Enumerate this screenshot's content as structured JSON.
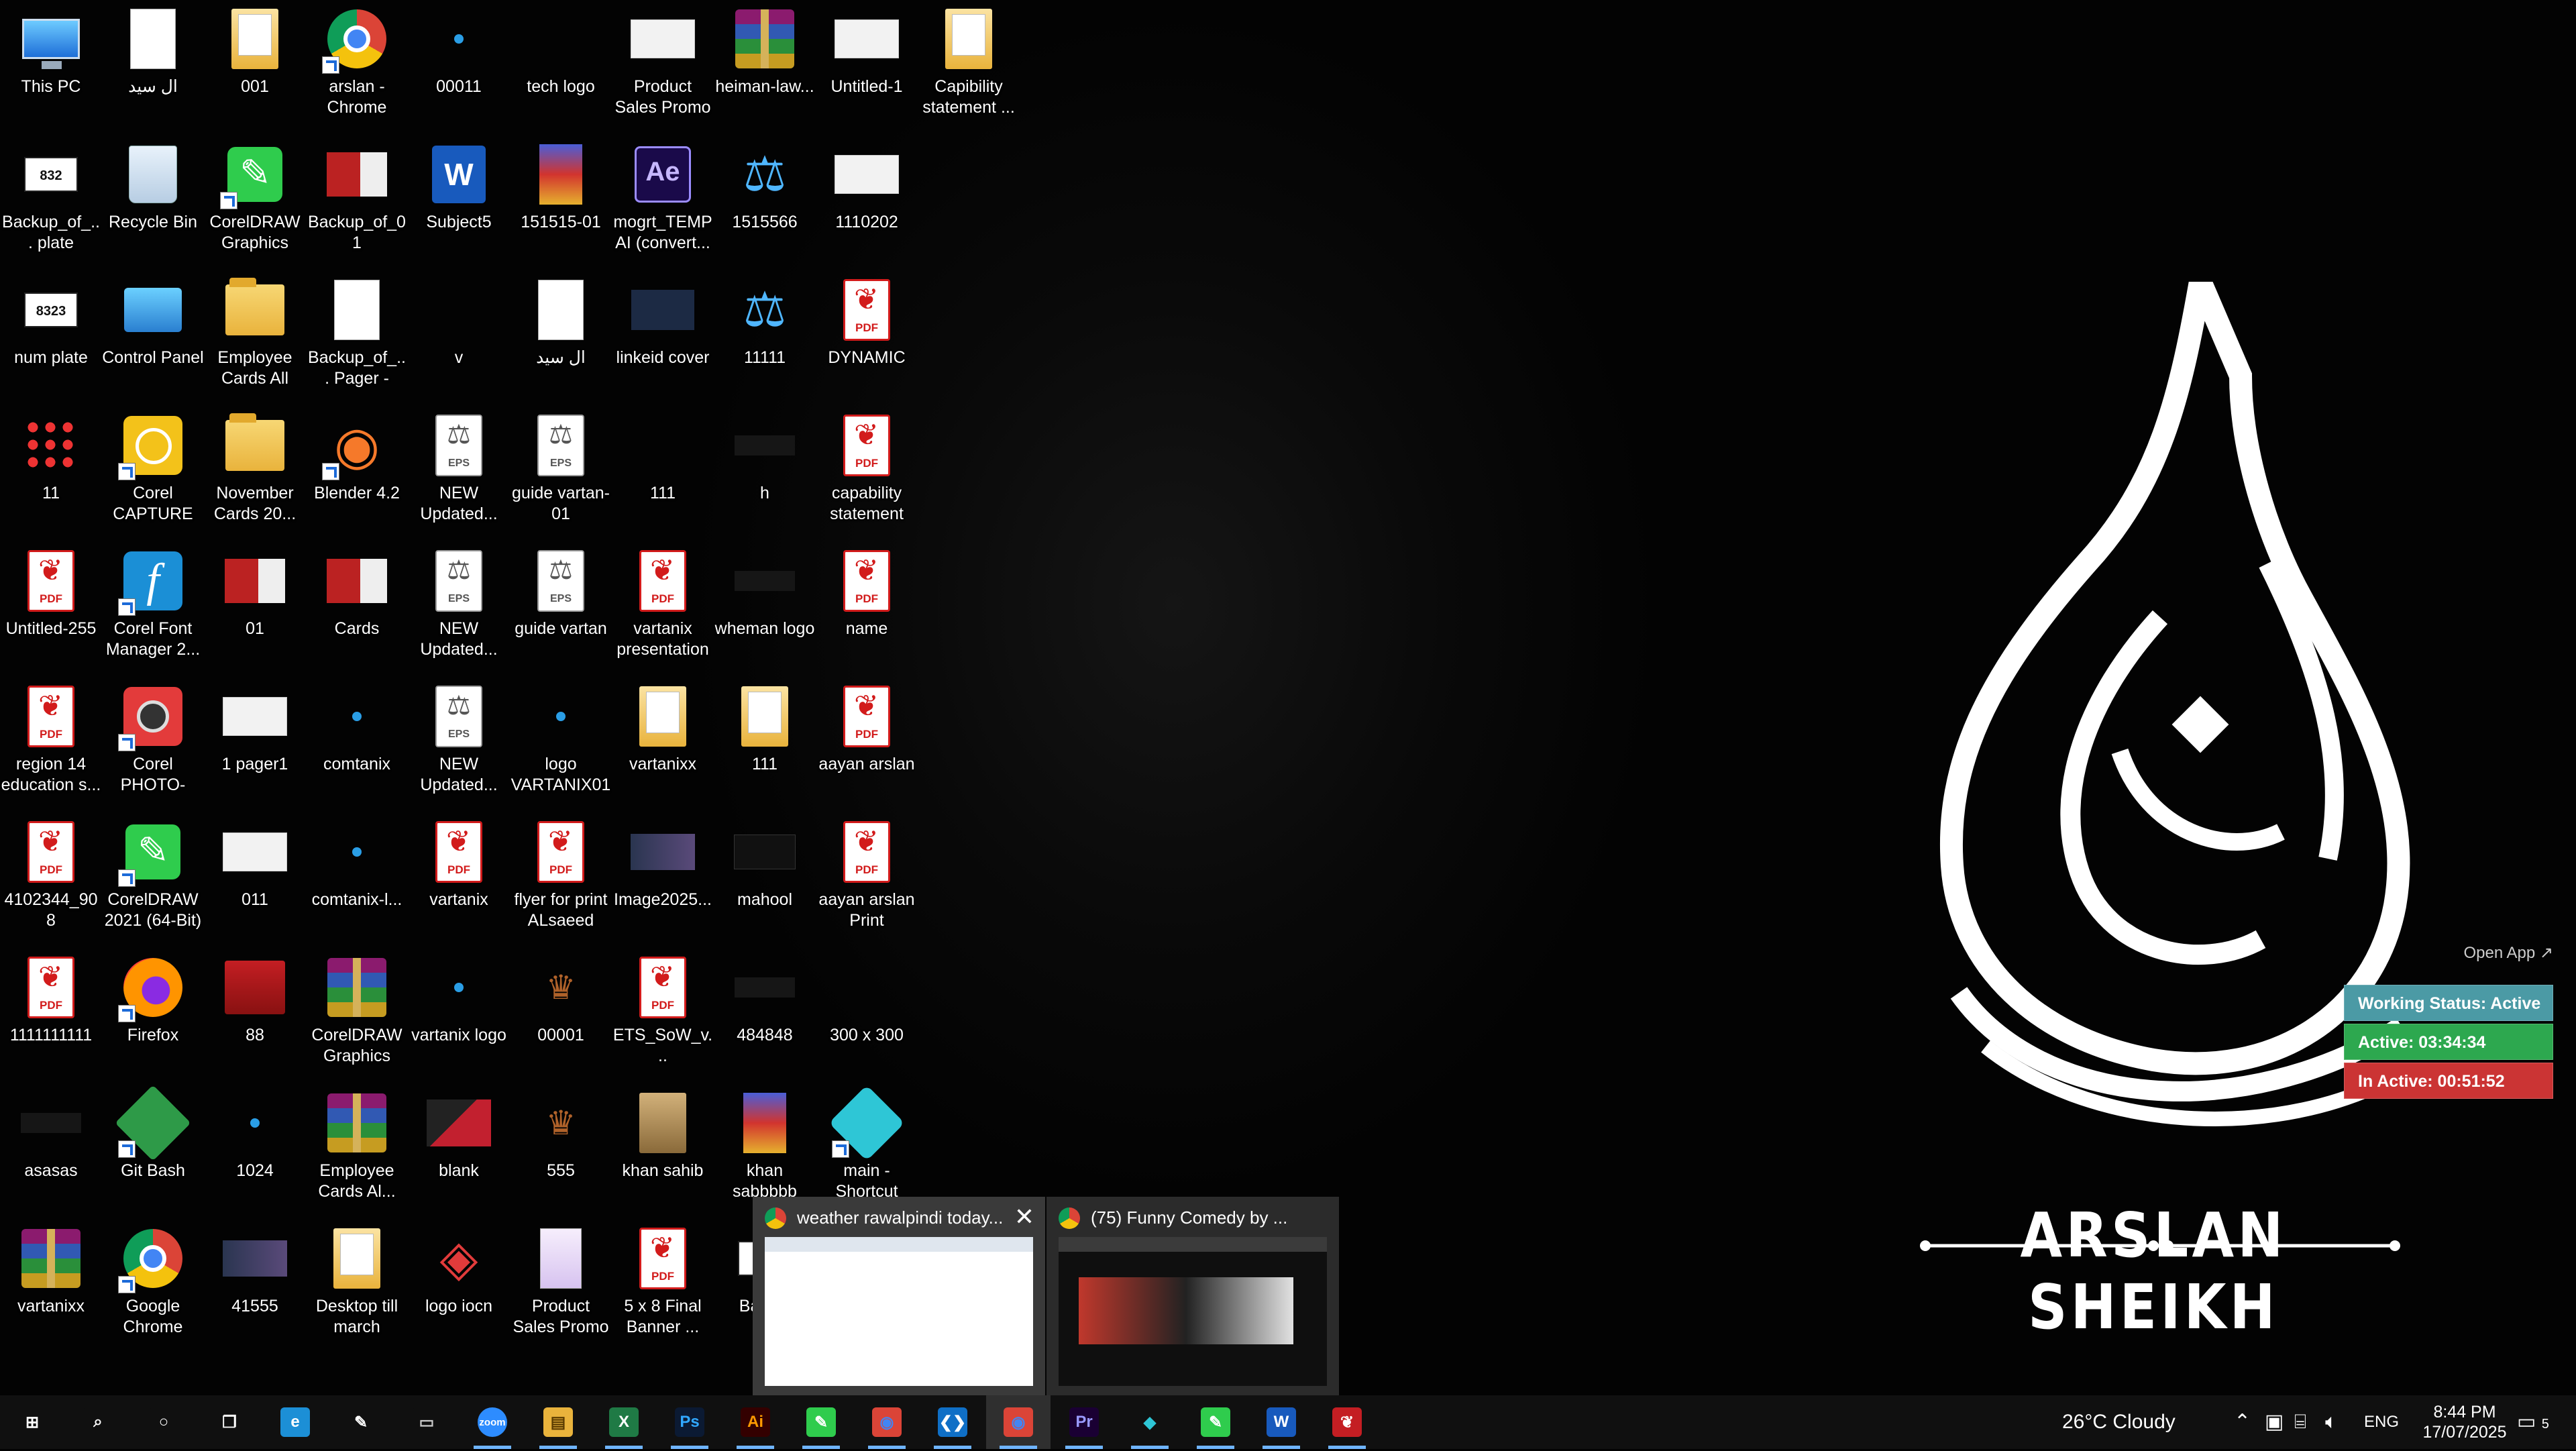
{
  "desktop": {
    "icons": [
      {
        "label": "This PC",
        "col": 0,
        "row": 0,
        "kind": "pc"
      },
      {
        "label": "ال سید",
        "col": 1,
        "row": 0,
        "kind": "doc"
      },
      {
        "label": "001",
        "col": 2,
        "row": 0,
        "kind": "folderdoc"
      },
      {
        "label": "arslan - Chrome",
        "col": 3,
        "row": 0,
        "kind": "chrome",
        "shortcut": true
      },
      {
        "label": "00011",
        "col": 4,
        "row": 0,
        "kind": "tiny"
      },
      {
        "label": "tech logo",
        "col": 5,
        "row": 0,
        "kind": "dot"
      },
      {
        "label": "Product Sales Promo Pack...",
        "col": 6,
        "row": 0,
        "kind": "thumbw"
      },
      {
        "label": "heiman-law...",
        "col": 7,
        "row": 0,
        "kind": "rar"
      },
      {
        "label": "Untitled-1",
        "col": 8,
        "row": 0,
        "kind": "thumbw"
      },
      {
        "label": "Capibility statement ...",
        "col": 9,
        "row": 0,
        "kind": "folderdoc"
      },
      {
        "label": "Backup_of_... plate",
        "col": 0,
        "row": 1,
        "kind": "plate",
        "text": "832"
      },
      {
        "label": "Recycle Bin",
        "col": 1,
        "row": 1,
        "kind": "recycle"
      },
      {
        "label": "CorelDRAW Graphics Su...",
        "col": 2,
        "row": 1,
        "kind": "cdr",
        "shortcut": true
      },
      {
        "label": "Backup_of_01",
        "col": 3,
        "row": 1,
        "kind": "cards"
      },
      {
        "label": "Subject5",
        "col": 4,
        "row": 1,
        "kind": "word",
        "text": "W"
      },
      {
        "label": "151515-01",
        "col": 5,
        "row": 1,
        "kind": "poster"
      },
      {
        "label": "mogrt_TEMP AI (convert...",
        "col": 6,
        "row": 1,
        "kind": "ae",
        "text": "Ae"
      },
      {
        "label": "1515566",
        "col": 7,
        "row": 1,
        "kind": "scale",
        "text": "⚖"
      },
      {
        "label": "1110202",
        "col": 8,
        "row": 1,
        "kind": "thumbw"
      },
      {
        "label": "num plate",
        "col": 0,
        "row": 2,
        "kind": "plate",
        "text": "8323"
      },
      {
        "label": "Control Panel",
        "col": 1,
        "row": 2,
        "kind": "cpanel"
      },
      {
        "label": "Employee Cards All",
        "col": 2,
        "row": 2,
        "kind": "folder"
      },
      {
        "label": "Backup_of_... Pager - NY...",
        "col": 3,
        "row": 2,
        "kind": "doc"
      },
      {
        "label": "v",
        "col": 4,
        "row": 2,
        "kind": "dot"
      },
      {
        "label": "ال سید",
        "col": 5,
        "row": 2,
        "kind": "doc"
      },
      {
        "label": "linkeid cover",
        "col": 6,
        "row": 2,
        "kind": "thumbd"
      },
      {
        "label": "11111",
        "col": 7,
        "row": 2,
        "kind": "scale",
        "text": "⚖"
      },
      {
        "label": "DYNAMIC",
        "col": 8,
        "row": 2,
        "kind": "pdf"
      },
      {
        "label": "11",
        "col": 0,
        "row": 3,
        "kind": "pixels"
      },
      {
        "label": "Corel CAPTURE 2...",
        "col": 1,
        "row": 3,
        "kind": "capture",
        "shortcut": true
      },
      {
        "label": "November Cards 20...",
        "col": 2,
        "row": 3,
        "kind": "folder"
      },
      {
        "label": "Blender 4.2",
        "col": 3,
        "row": 3,
        "kind": "blender",
        "text": "◉",
        "shortcut": true
      },
      {
        "label": "NEW Updated...",
        "col": 4,
        "row": 3,
        "kind": "eps"
      },
      {
        "label": "guide vartan-01",
        "col": 5,
        "row": 3,
        "kind": "eps"
      },
      {
        "label": "111",
        "col": 6,
        "row": 3,
        "kind": "dot"
      },
      {
        "label": "h",
        "col": 7,
        "row": 3,
        "kind": "faint"
      },
      {
        "label": "capability statement",
        "col": 8,
        "row": 3,
        "kind": "pdf"
      },
      {
        "label": "Untitled-255",
        "col": 0,
        "row": 4,
        "kind": "pdf"
      },
      {
        "label": "Corel Font Manager 2...",
        "col": 1,
        "row": 4,
        "kind": "font",
        "text": "f",
        "shortcut": true
      },
      {
        "label": "01",
        "col": 2,
        "row": 4,
        "kind": "cards"
      },
      {
        "label": "Cards",
        "col": 3,
        "row": 4,
        "kind": "cards"
      },
      {
        "label": "NEW Updated...",
        "col": 4,
        "row": 4,
        "kind": "eps"
      },
      {
        "label": "guide vartan",
        "col": 5,
        "row": 4,
        "kind": "eps"
      },
      {
        "label": "vartanix presentation",
        "col": 6,
        "row": 4,
        "kind": "pdf"
      },
      {
        "label": "wheman logo",
        "col": 7,
        "row": 4,
        "kind": "faint"
      },
      {
        "label": "name",
        "col": 8,
        "row": 4,
        "kind": "pdf"
      },
      {
        "label": "region 14 education s...",
        "col": 0,
        "row": 5,
        "kind": "pdf"
      },
      {
        "label": "Corel PHOTO-PAI...",
        "col": 1,
        "row": 5,
        "kind": "photopaint",
        "shortcut": true
      },
      {
        "label": "1 pager1",
        "col": 2,
        "row": 5,
        "kind": "thumbw"
      },
      {
        "label": "comtanix",
        "col": 3,
        "row": 5,
        "kind": "tiny"
      },
      {
        "label": "NEW Updated...",
        "col": 4,
        "row": 5,
        "kind": "eps"
      },
      {
        "label": "logo VARTANIX01",
        "col": 5,
        "row": 5,
        "kind": "tiny"
      },
      {
        "label": "vartanixx",
        "col": 6,
        "row": 5,
        "kind": "folderdoc"
      },
      {
        "label": "111",
        "col": 7,
        "row": 5,
        "kind": "folderdoc"
      },
      {
        "label": "aayan arslan",
        "col": 8,
        "row": 5,
        "kind": "pdf"
      },
      {
        "label": "4102344_908",
        "col": 0,
        "row": 6,
        "kind": "pdf"
      },
      {
        "label": "CorelDRAW 2021 (64-Bit)",
        "col": 1,
        "row": 6,
        "kind": "cdr",
        "shortcut": true
      },
      {
        "label": "011",
        "col": 2,
        "row": 6,
        "kind": "thumbw"
      },
      {
        "label": "comtanix-l...",
        "col": 3,
        "row": 6,
        "kind": "tiny"
      },
      {
        "label": "vartanix",
        "col": 4,
        "row": 6,
        "kind": "pdf"
      },
      {
        "label": "flyer for print ALsaeed po...",
        "col": 5,
        "row": 6,
        "kind": "pdf"
      },
      {
        "label": "Image2025...",
        "col": 6,
        "row": 6,
        "kind": "bgpic"
      },
      {
        "label": "mahool",
        "col": 7,
        "row": 6,
        "kind": "mahool"
      },
      {
        "label": "aayan arslan Print",
        "col": 8,
        "row": 6,
        "kind": "pdf"
      },
      {
        "label": "1111111111",
        "col": 0,
        "row": 7,
        "kind": "pdf"
      },
      {
        "label": "Firefox",
        "col": 1,
        "row": 7,
        "kind": "firefox",
        "shortcut": true
      },
      {
        "label": "88",
        "col": 2,
        "row": 7,
        "kind": "red88"
      },
      {
        "label": "CorelDRAW Graphics Su...",
        "col": 3,
        "row": 7,
        "kind": "rar"
      },
      {
        "label": "vartanix logo",
        "col": 4,
        "row": 7,
        "kind": "tiny"
      },
      {
        "label": "00001",
        "col": 5,
        "row": 7,
        "kind": "brown",
        "text": "♛"
      },
      {
        "label": "ETS_SoW_v...",
        "col": 6,
        "row": 7,
        "kind": "pdf"
      },
      {
        "label": "484848",
        "col": 7,
        "row": 7,
        "kind": "faint"
      },
      {
        "label": "300 x 300",
        "col": 8,
        "row": 7,
        "kind": "dot"
      },
      {
        "label": "asasas",
        "col": 0,
        "row": 8,
        "kind": "faint"
      },
      {
        "label": "Git Bash",
        "col": 1,
        "row": 8,
        "kind": "git",
        "shortcut": true
      },
      {
        "label": "1024",
        "col": 2,
        "row": 8,
        "kind": "tiny"
      },
      {
        "label": "Employee Cards Al...",
        "col": 3,
        "row": 8,
        "kind": "rar"
      },
      {
        "label": "blank",
        "col": 4,
        "row": 8,
        "kind": "thumbr"
      },
      {
        "label": "555",
        "col": 5,
        "row": 8,
        "kind": "brown",
        "text": "♛"
      },
      {
        "label": "khan sahib",
        "col": 6,
        "row": 8,
        "kind": "book"
      },
      {
        "label": "khan sabbbbb",
        "col": 7,
        "row": 8,
        "kind": "poster"
      },
      {
        "label": "main - Shortcut",
        "col": 8,
        "row": 8,
        "kind": "main",
        "shortcut": true
      },
      {
        "label": "vartanixx",
        "col": 0,
        "row": 9,
        "kind": "rar"
      },
      {
        "label": "Google Chrome",
        "col": 1,
        "row": 9,
        "kind": "chrome",
        "shortcut": true
      },
      {
        "label": "41555",
        "col": 2,
        "row": 9,
        "kind": "bgpic"
      },
      {
        "label": "Desktop till march",
        "col": 3,
        "row": 9,
        "kind": "folderdoc"
      },
      {
        "label": "logo iocn",
        "col": 4,
        "row": 9,
        "kind": "logoiocn",
        "text": "◈"
      },
      {
        "label": "Product Sales Promo Pack...",
        "col": 5,
        "row": 9,
        "kind": "docp"
      },
      {
        "label": "5 x 8 Final Banner ...",
        "col": 6,
        "row": 9,
        "kind": "pdf"
      },
      {
        "label": "Back...",
        "col": 7,
        "row": 9,
        "kind": "plate",
        "text": "832"
      }
    ]
  },
  "wallpaper": {
    "name": "ARSLAN SHEIKH"
  },
  "widget": {
    "open_app": "Open App ↗",
    "status": "Working Status: Active",
    "active": "Active: 03:34:34",
    "inactive": "In Active: 00:51:52"
  },
  "previews": [
    {
      "title": "weather rawalpindi today...",
      "close": "✕"
    },
    {
      "title": "(75) Funny Comedy by ..."
    }
  ],
  "taskbar": {
    "apps": [
      {
        "name": "start-button",
        "glyph": "⊞",
        "color": "#101010",
        "fg": "#ffffff"
      },
      {
        "name": "search-button",
        "glyph": "⌕",
        "color": "#101010",
        "fg": "#ffffff"
      },
      {
        "name": "cortana-button",
        "glyph": "○",
        "color": "#101010",
        "fg": "#ffffff"
      },
      {
        "name": "task-view-button",
        "glyph": "❐",
        "color": "#101010",
        "fg": "#ffffff"
      },
      {
        "name": "edge-app",
        "glyph": "e",
        "color": "#1c8fd6",
        "fg": "#ffffff"
      },
      {
        "name": "pen-app",
        "glyph": "✎",
        "color": "#101010",
        "fg": "#ffffff"
      },
      {
        "name": "terminal-app",
        "glyph": "▭",
        "color": "#101010",
        "fg": "#cccccc"
      },
      {
        "name": "zoom-app",
        "glyph": "zoom",
        "color": "#2d8cff",
        "fg": "#ffffff",
        "running": true
      },
      {
        "name": "file-explorer-app",
        "glyph": "▤",
        "color": "#e9b33c",
        "fg": "#5a3b00",
        "running": true
      },
      {
        "name": "excel-app",
        "glyph": "X",
        "color": "#1f7a45",
        "fg": "#ffffff",
        "running": true
      },
      {
        "name": "photoshop-app",
        "glyph": "Ps",
        "color": "#0b1a33",
        "fg": "#31a8ff",
        "running": true
      },
      {
        "name": "illustrator-app",
        "glyph": "Ai",
        "color": "#330000",
        "fg": "#ff9a00",
        "running": true
      },
      {
        "name": "coreldraw-app",
        "glyph": "✎",
        "color": "#2fcc4d",
        "fg": "#ffffff",
        "running": true
      },
      {
        "name": "chrome-app",
        "glyph": "◉",
        "color": "#db4437",
        "fg": "#4285f4",
        "running": true
      },
      {
        "name": "vscode-app",
        "glyph": "❮❯",
        "color": "#0f6fc6",
        "fg": "#ffffff",
        "running": true
      },
      {
        "name": "chrome-app-2",
        "glyph": "◉",
        "color": "#db4437",
        "fg": "#4285f4",
        "running": true,
        "active": true
      },
      {
        "name": "premiere-app",
        "glyph": "Pr",
        "color": "#1a0033",
        "fg": "#9999ff",
        "running": true
      },
      {
        "name": "main-app",
        "glyph": "◆",
        "color": "#101010",
        "fg": "#2ec6d6",
        "running": true
      },
      {
        "name": "coreldraw-app-2",
        "glyph": "✎",
        "color": "#2fcc4d",
        "fg": "#ffffff",
        "running": true
      },
      {
        "name": "word-app",
        "glyph": "W",
        "color": "#185abd",
        "fg": "#ffffff",
        "running": true
      },
      {
        "name": "acrobat-app",
        "glyph": "❦",
        "color": "#c41e23",
        "fg": "#ffffff",
        "running": true
      }
    ],
    "weather": "26°C  Cloudy",
    "lang": "ENG",
    "time": "8:44 PM",
    "date": "17/07/2025",
    "notifications": "5"
  }
}
